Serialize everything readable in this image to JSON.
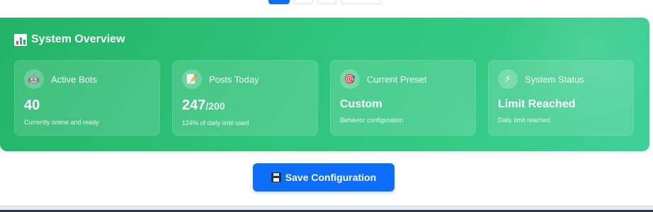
{
  "overview": {
    "title": "System Overview",
    "title_icon": "bar-chart-icon",
    "cards": [
      {
        "icon": "robot-icon",
        "glyph": "🤖",
        "label": "Active Bots",
        "value": "40",
        "denominator": "",
        "sub": "Currently online and ready"
      },
      {
        "icon": "memo-icon",
        "glyph": "📝",
        "label": "Posts Today",
        "value": "247",
        "denominator": "/200",
        "sub": "124% of daily limit used"
      },
      {
        "icon": "target-icon",
        "glyph": "🎯",
        "label": "Current Preset",
        "value": "Custom",
        "denominator": "",
        "sub": "Behavior configuration"
      },
      {
        "icon": "lightning-icon",
        "glyph": "⚡",
        "label": "System Status",
        "value": "Limit Reached",
        "denominator": "",
        "sub": "Daily limit reached"
      }
    ]
  },
  "save_button": {
    "label": "Save Configuration",
    "icon": "floppy-disk-icon"
  },
  "colors": {
    "accent": "#0d6efd",
    "overview_gradient_start": "#22b366",
    "overview_gradient_end": "#3fd09b"
  }
}
